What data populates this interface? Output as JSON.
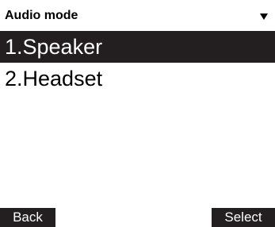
{
  "title_bar": {
    "title": "Audio mode",
    "scroll_icon": "triangle-down-icon"
  },
  "menu": {
    "items": [
      {
        "label": "1.Speaker",
        "selected": true
      },
      {
        "label": "2.Headset",
        "selected": false
      }
    ]
  },
  "softkeys": {
    "left_label": "Back",
    "right_label": "Select"
  },
  "colors": {
    "highlight": "#231f20",
    "background": "#ffffff",
    "text": "#000000"
  }
}
